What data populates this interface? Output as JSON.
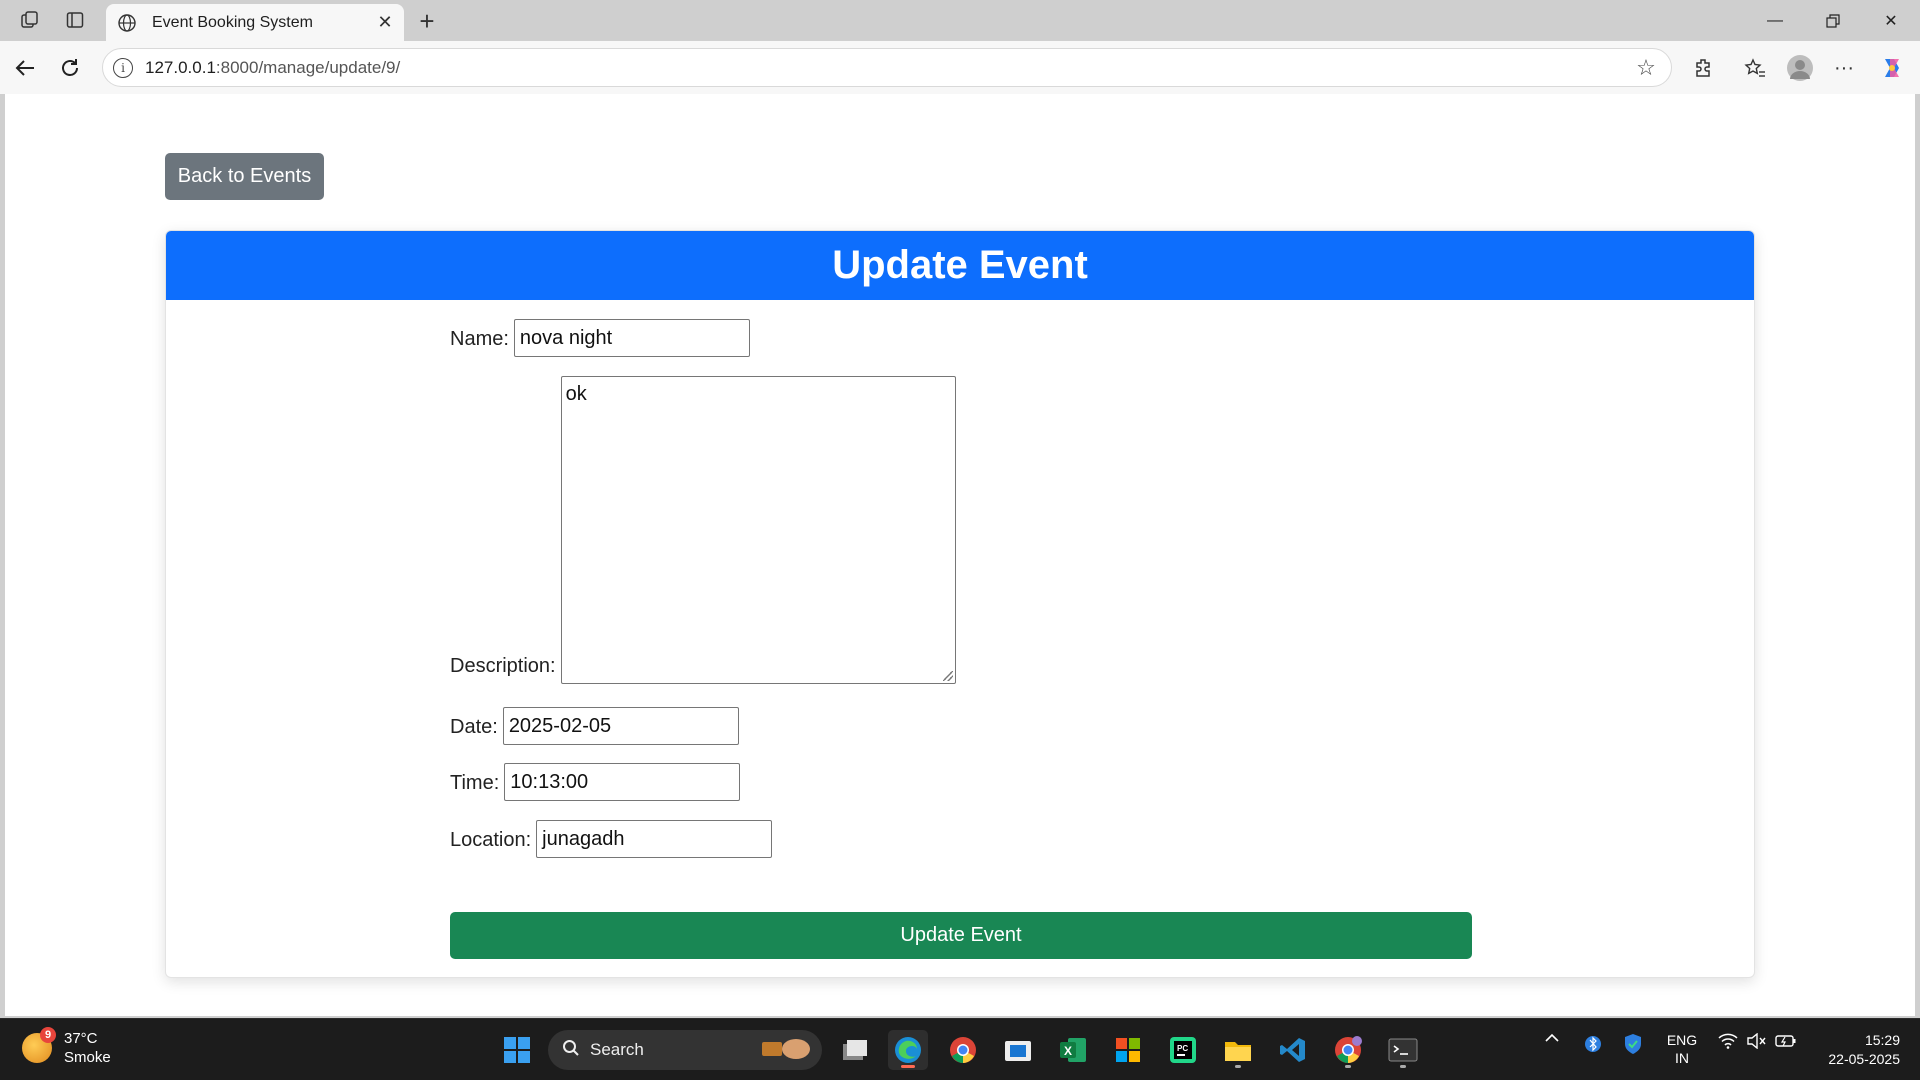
{
  "browser": {
    "tab_title": "Event Booking System",
    "url_host": "127.0.0.1",
    "url_path": ":8000/manage/update/9/"
  },
  "page": {
    "back_label": "Back to Events",
    "card_title": "Update Event",
    "form": {
      "name_label": "Name:",
      "name_value": "nova night",
      "description_label": "Description:",
      "description_value": "ok",
      "date_label": "Date:",
      "date_value": "2025-02-05",
      "time_label": "Time:",
      "time_value": "10:13:00",
      "location_label": "Location:",
      "location_value": "junagadh"
    },
    "submit_label": "Update Event"
  },
  "taskbar": {
    "weather_temp": "37°C",
    "weather_desc": "Smoke",
    "weather_badge": "9",
    "search_label": "Search",
    "lang_line1": "ENG",
    "lang_line2": "IN",
    "time": "15:29",
    "date": "22-05-2025"
  },
  "colors": {
    "header_blue": "#0d6efd",
    "submit_green": "#198754",
    "back_gray": "#6c757d"
  }
}
